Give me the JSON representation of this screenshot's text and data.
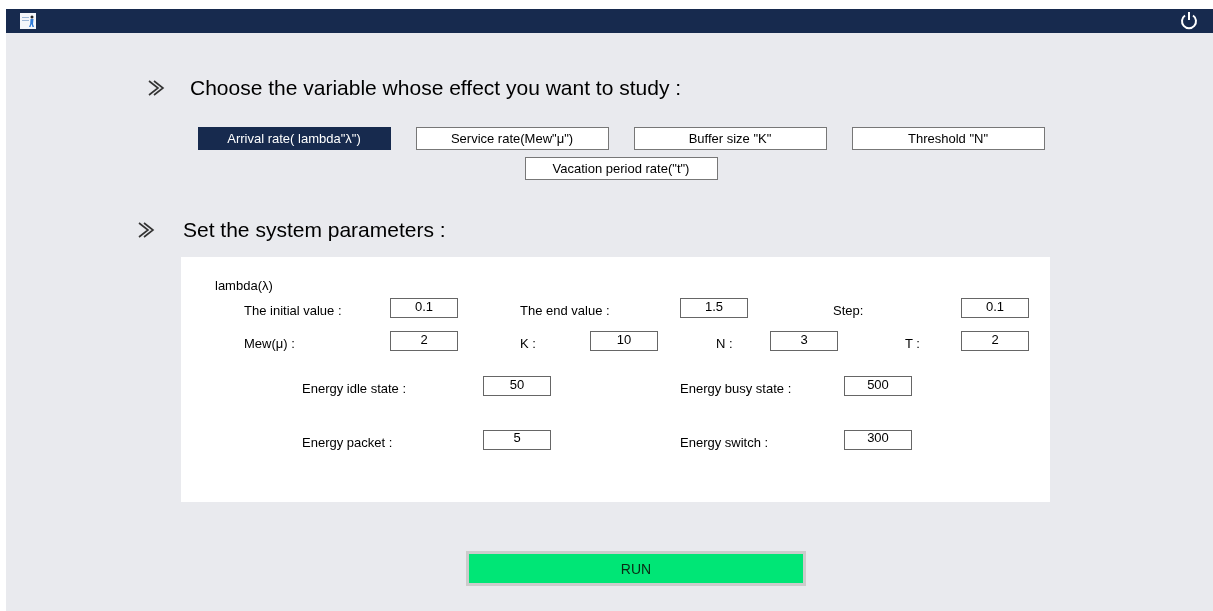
{
  "variable_section": {
    "heading": "Choose the variable whose effect you want to study :",
    "options": [
      {
        "label": "Arrival rate( lambda\"λ\")",
        "selected": true
      },
      {
        "label": "Service rate(Mew\"μ\")",
        "selected": false
      },
      {
        "label": "Buffer size \"K\"",
        "selected": false
      },
      {
        "label": "Threshold \"N\"",
        "selected": false
      },
      {
        "label": "Vacation period rate(\"t\")",
        "selected": false
      }
    ]
  },
  "parameters_section": {
    "heading": "Set the system parameters :",
    "lambda_range": {
      "group_label": "lambda(λ)",
      "fields": [
        {
          "label": "The initial value :",
          "value": "0.1"
        },
        {
          "label": "The end value :",
          "value": "1.5"
        },
        {
          "label": "Step:",
          "value": "0.1"
        }
      ]
    },
    "system_fields": [
      {
        "label": "Mew(μ) :",
        "value": "2"
      },
      {
        "label": "K :",
        "value": "10"
      },
      {
        "label": "N :",
        "value": "3"
      },
      {
        "label": "T :",
        "value": "2"
      }
    ],
    "energy_fields": [
      {
        "label": "Energy idle state :",
        "value": "50"
      },
      {
        "label": "Energy busy state :",
        "value": "500"
      },
      {
        "label": "Energy packet :",
        "value": "5"
      },
      {
        "label": "Energy switch :",
        "value": "300"
      }
    ]
  },
  "run_button": "RUN"
}
